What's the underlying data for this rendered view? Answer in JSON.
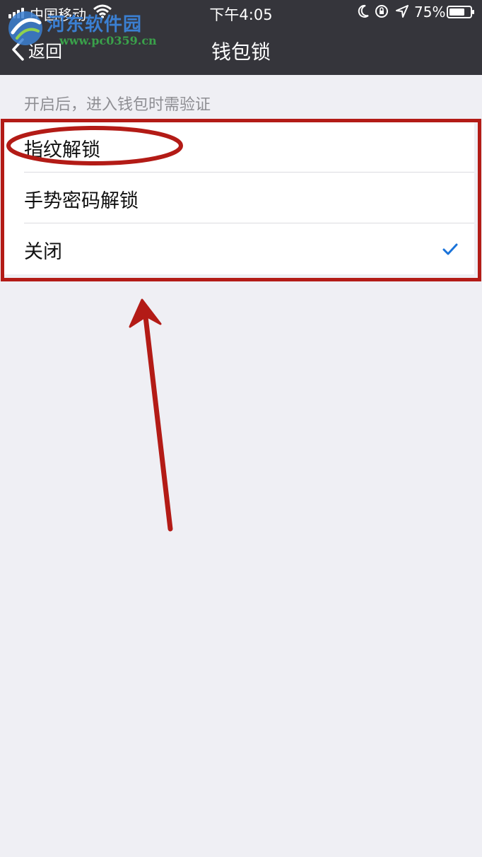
{
  "status_bar": {
    "carrier": "中国移动",
    "time": "下午4:05",
    "battery_percent": "75%",
    "battery_level": 0.75,
    "icons": [
      "signal-icon",
      "wifi-icon",
      "moon-icon",
      "lock-rotation-icon",
      "location-icon",
      "battery-icon"
    ]
  },
  "nav": {
    "back_label": "返回",
    "title": "钱包锁"
  },
  "watermark": {
    "name": "河东软件园",
    "url": "www.pc0359.cn"
  },
  "section": {
    "header": "开启后，进入钱包时需验证"
  },
  "options": [
    {
      "label": "指纹解锁",
      "selected": false
    },
    {
      "label": "手势密码解锁",
      "selected": false
    },
    {
      "label": "关闭",
      "selected": true
    }
  ],
  "colors": {
    "nav_background": "#35353b",
    "page_background": "#efeff4",
    "check_blue": "#1a73d9",
    "annotation_red": "#b31b16",
    "watermark_blue": "#3b7fd1",
    "watermark_green": "#3aa14a"
  }
}
